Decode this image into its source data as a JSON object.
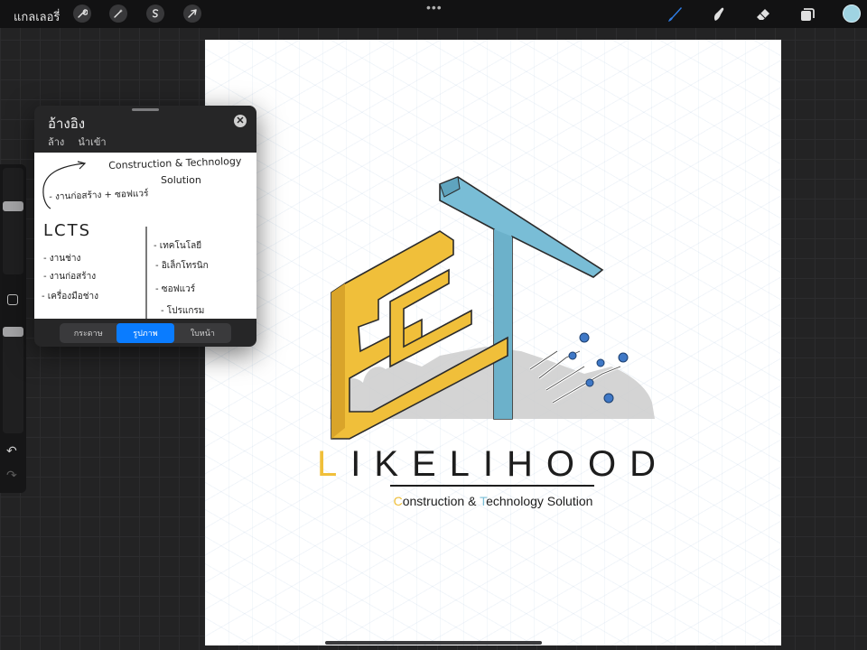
{
  "toolbar": {
    "gallery_label": "แกลเลอรี่",
    "menu_dots": "•••",
    "accent_color": "#2f7ee8",
    "current_color": "#9fd3e2",
    "left_tools": [
      "wrench-icon",
      "magic-wand-icon",
      "selection-icon",
      "transform-arrow-icon"
    ],
    "right_tools": [
      "brush-icon",
      "smudge-icon",
      "eraser-icon",
      "layers-icon"
    ]
  },
  "sidebar": {
    "undo_glyph": "↶",
    "redo_glyph": "↷"
  },
  "reference": {
    "title": "อ้างอิง",
    "close_glyph": "✕",
    "actions": [
      "ล้าง",
      "นำเข้า"
    ],
    "notes": {
      "line1": "Construction & Technology",
      "line2": "Solution",
      "line3": "- งานก่อสร้าง + ซอฟแวร์",
      "lcts": "LCTS",
      "left_list": [
        "- งานช่าง",
        "- งานก่อสร้าง",
        "- เครื่องมือช่าง"
      ],
      "right_list": [
        "- เทคโนโลยี",
        "- อิเล็กโทรนิก",
        "- ซอฟแวร์",
        "- โปรแกรม"
      ]
    },
    "tabs": [
      "กระดาษ",
      "รูปภาพ",
      "ใบหน้า"
    ],
    "active_tab": "รูปภาพ"
  },
  "canvas": {
    "brand_first": "L",
    "brand_rest": "IKELIHOOD",
    "tag_c": "C",
    "tag_mid": "onstruction & ",
    "tag_t": "T",
    "tag_rest": "echnology Solution",
    "colors": {
      "yellow": "#f0bf3a",
      "blue": "#79bdd6",
      "gray": "#c8c8c8",
      "dot": "#3f78c6"
    }
  }
}
